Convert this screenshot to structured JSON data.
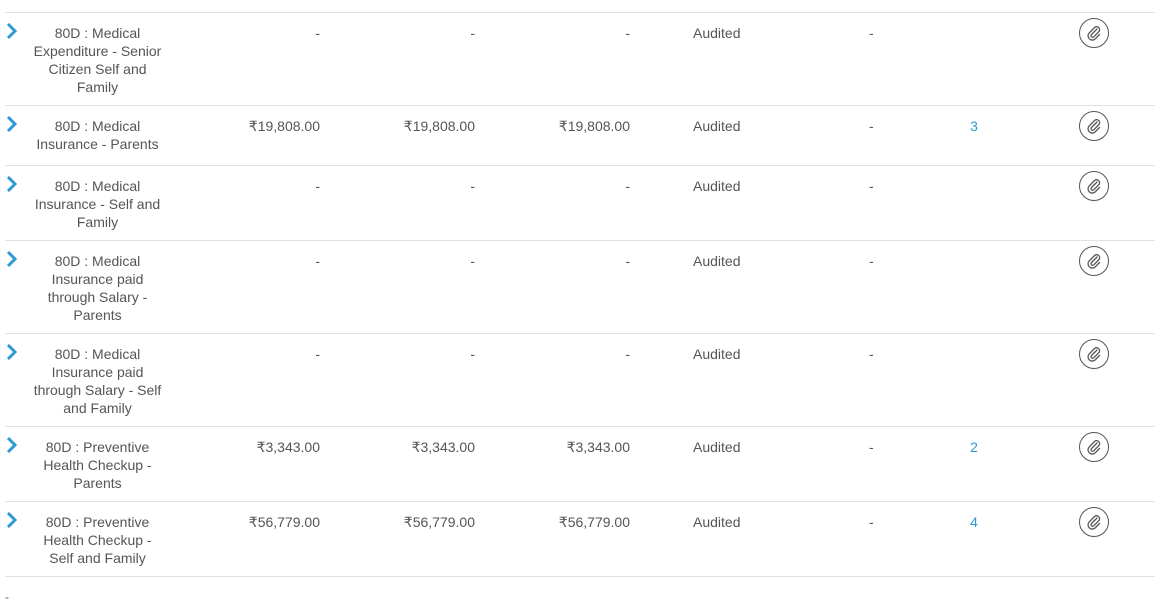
{
  "rows": [
    {
      "name": "80D : Medical Expenditure - Senior Citizen Self and Family",
      "declared": "-",
      "proposed": "-",
      "approved": "-",
      "status": "Audited",
      "remark": "-",
      "attachments": ""
    },
    {
      "name": "80D : Medical Insurance - Parents",
      "declared": "₹19,808.00",
      "proposed": "₹19,808.00",
      "approved": "₹19,808.00",
      "status": "Audited",
      "remark": "-",
      "attachments": "3"
    },
    {
      "name": "80D : Medical Insurance - Self and Family",
      "declared": "-",
      "proposed": "-",
      "approved": "-",
      "status": "Audited",
      "remark": "-",
      "attachments": ""
    },
    {
      "name": "80D : Medical Insurance paid through Salary - Parents",
      "declared": "-",
      "proposed": "-",
      "approved": "-",
      "status": "Audited",
      "remark": "-",
      "attachments": ""
    },
    {
      "name": "80D : Medical Insurance paid through Salary - Self and Family",
      "declared": "-",
      "proposed": "-",
      "approved": "-",
      "status": "Audited",
      "remark": "-",
      "attachments": ""
    },
    {
      "name": "80D : Preventive Health Checkup - Parents",
      "declared": "₹3,343.00",
      "proposed": "₹3,343.00",
      "approved": "₹3,343.00",
      "status": "Audited",
      "remark": "-",
      "attachments": "2"
    },
    {
      "name": "80D : Preventive Health Checkup - Self and Family",
      "declared": "₹56,779.00",
      "proposed": "₹56,779.00",
      "approved": "₹56,779.00",
      "status": "Audited",
      "remark": "-",
      "attachments": "4"
    }
  ],
  "footer": {
    "dash": "-"
  },
  "icons": {
    "expand": "chevron-right-icon",
    "attach": "paperclip-icon"
  },
  "colors": {
    "accent": "#2d9ad6",
    "border": "#e2e2e2",
    "text": "#555555"
  }
}
